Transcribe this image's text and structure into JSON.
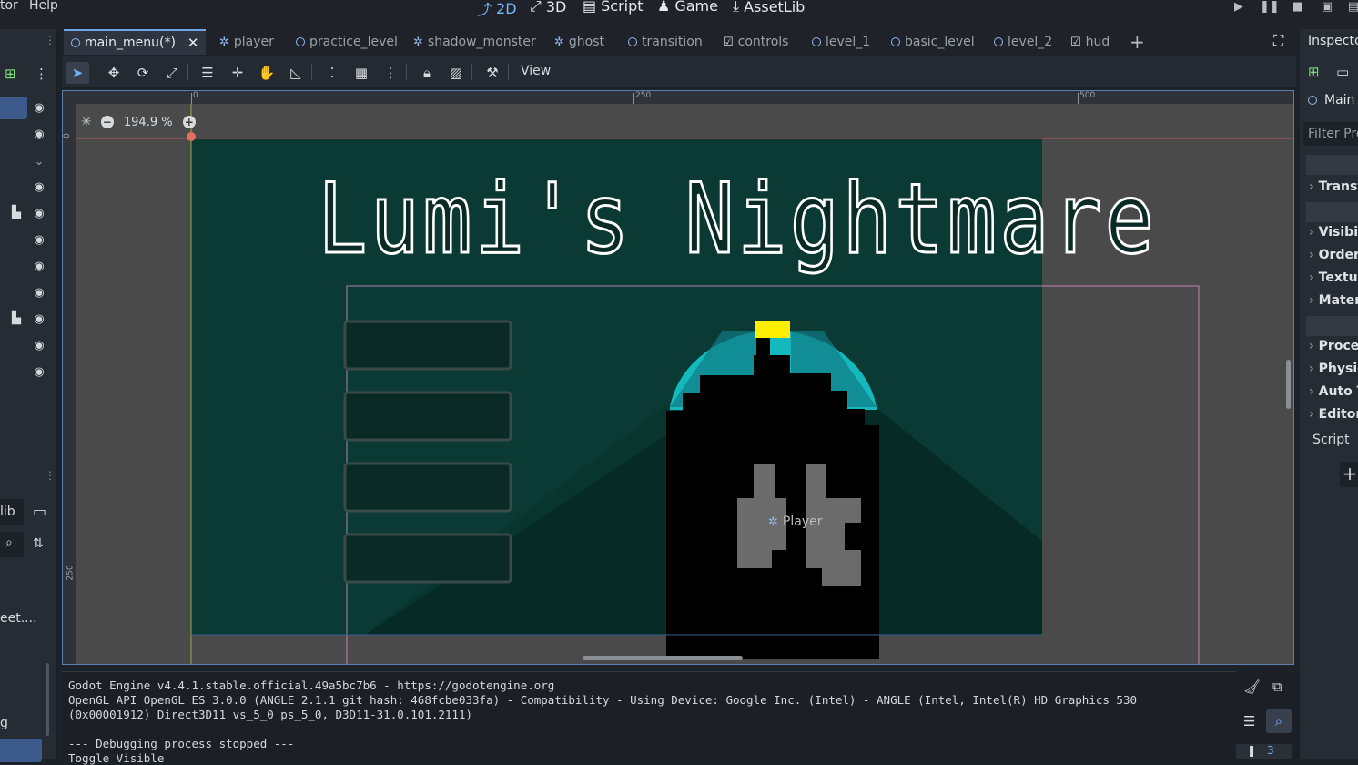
{
  "menu": {
    "editor_partial": "tor",
    "help": "Help"
  },
  "workspaces": [
    {
      "label": "2D",
      "icon": "2d-icon",
      "active": true
    },
    {
      "label": "3D",
      "icon": "3d-icon",
      "active": false
    },
    {
      "label": "Script",
      "icon": "script-icon",
      "active": false
    },
    {
      "label": "Game",
      "icon": "game-icon",
      "active": false
    },
    {
      "label": "AssetLib",
      "icon": "assetlib-icon",
      "active": false
    }
  ],
  "tabs": [
    {
      "label": "main_menu(*)",
      "icon": "node-circle-icon",
      "current": true
    },
    {
      "label": "player",
      "icon": "character-icon"
    },
    {
      "label": "practice_level",
      "icon": "node-circle-icon"
    },
    {
      "label": "shadow_monster",
      "icon": "character-icon"
    },
    {
      "label": "ghost",
      "icon": "character-icon"
    },
    {
      "label": "transition",
      "icon": "node-circle-icon"
    },
    {
      "label": "controls",
      "icon": "control-icon"
    },
    {
      "label": "level_1",
      "icon": "node-circle-icon"
    },
    {
      "label": "basic_level",
      "icon": "node-circle-icon"
    },
    {
      "label": "level_2",
      "icon": "node-circle-icon"
    },
    {
      "label": "hud",
      "icon": "control-icon"
    }
  ],
  "toolbar": {
    "view_label": "View"
  },
  "viewport": {
    "zoom": "194.9 %",
    "ruler_top": [
      "0",
      "250",
      "500"
    ],
    "ruler_left": [
      "0",
      "250"
    ],
    "game_title": "Lumi's Nightmare",
    "player_label": "Player",
    "colors": {
      "scene_bg": "#0a3a33",
      "lamp_cyan": "#15b9bd",
      "lamp_yellow": "#ffee00",
      "player_gray": "#6b6b6b"
    }
  },
  "left_dock": {
    "filter_partial": "lib",
    "file_partial": "eet....",
    "debug_partial": "g"
  },
  "inspector": {
    "title": "Inspecto",
    "node_name": "Main",
    "filter": "Filter Pro",
    "sections": [
      "Transf",
      "Visibil",
      "Order",
      "Textur",
      "Mater",
      "Proces",
      "Physic",
      "Auto T",
      "Editor"
    ],
    "script_label": "Script"
  },
  "output": {
    "lines": [
      "Godot Engine v4.4.1.stable.official.49a5bc7b6 - https://godotengine.org",
      "OpenGL API OpenGL ES 3.0.0 (ANGLE 2.1.1 git hash: 468fcbe033fa) - Compatibility - Using Device: Google Inc. (Intel) - ANGLE (Intel, Intel(R) HD Graphics 530",
      "(0x00001912) Direct3D11 vs_5_0 ps_5_0, D3D11-31.0.101.2111)",
      "",
      "--- Debugging process stopped ---",
      "Toggle Visible"
    ],
    "badge": "3"
  }
}
